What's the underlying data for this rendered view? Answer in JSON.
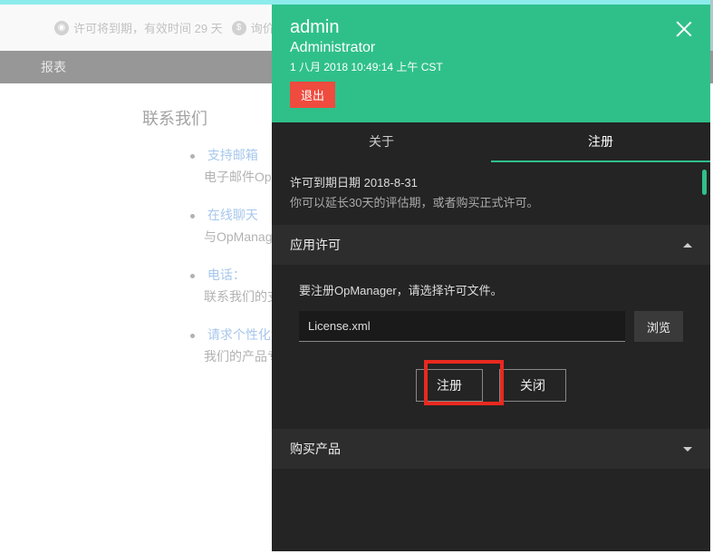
{
  "header": {
    "license_badge": "许可将到期，有效时间 29 天",
    "price_badge": "询价"
  },
  "nav": {
    "item": "报表"
  },
  "contact": {
    "heading": "联系我们",
    "items": [
      {
        "link": "支持邮箱",
        "sub": "电子邮件OpManager支持团队"
      },
      {
        "link": "在线聊天",
        "sub": "与OpManager支持团队打开实时聊天会话"
      },
      {
        "link": "电话：",
        "sub": "联系我们的支持团队"
      },
      {
        "link": "请求个性化演示",
        "sub": "我们的产品专家为您量身定制"
      }
    ]
  },
  "panel": {
    "user": "admin",
    "role": "Administrator",
    "timestamp": "1 八月 2018 10:49:14 上午 CST",
    "logout": "退出",
    "tabs": {
      "about": "关于",
      "register": "注册"
    },
    "license_info": {
      "expire": "许可到期日期 2018-8-31",
      "desc": "你可以延长30天的评估期，或者购买正式许可。"
    },
    "accordion": {
      "app_license": "应用许可",
      "hint": "要注册OpManager，请选择许可文件。",
      "file_value": "License.xml",
      "browse": "浏览",
      "register_btn": "注册",
      "close_btn": "关闭",
      "purchase": "购买产品"
    }
  }
}
